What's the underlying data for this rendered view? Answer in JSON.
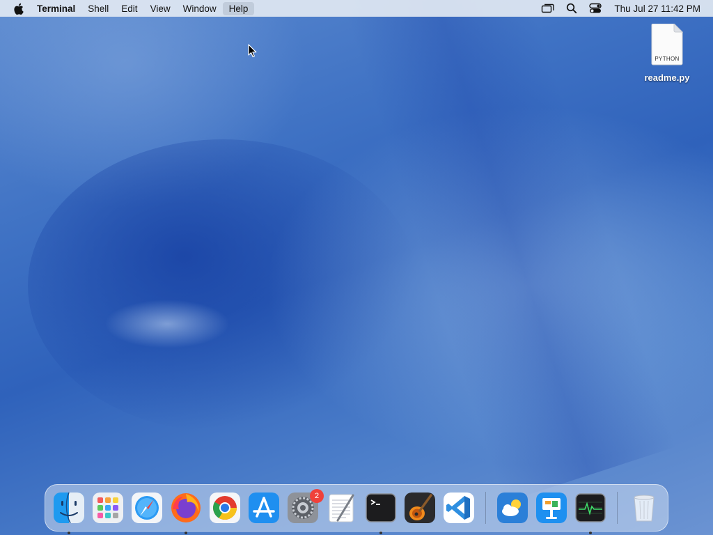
{
  "menubar": {
    "app_name": "Terminal",
    "items": [
      "Shell",
      "Edit",
      "View",
      "Window",
      "Help"
    ],
    "clock": "Thu Jul 27  11:42 PM",
    "status_icons": [
      "screen-mirroring-icon",
      "spotlight-search-icon",
      "control-center-icon"
    ]
  },
  "desktop": {
    "file": {
      "name": "readme.py",
      "type_label": "PYTHON",
      "icon": "python-file-icon"
    }
  },
  "dock": {
    "apps": [
      {
        "name": "Finder",
        "icon": "finder-icon",
        "running": true
      },
      {
        "name": "Launchpad",
        "icon": "launchpad-icon",
        "running": false
      },
      {
        "name": "Safari",
        "icon": "safari-icon",
        "running": false
      },
      {
        "name": "Firefox",
        "icon": "firefox-icon",
        "running": true
      },
      {
        "name": "Google Chrome",
        "icon": "chrome-icon",
        "running": false
      },
      {
        "name": "App Store",
        "icon": "app-store-icon",
        "running": false
      },
      {
        "name": "System Settings",
        "icon": "system-settings-icon",
        "running": false,
        "badge": "2"
      },
      {
        "name": "TextEdit",
        "icon": "textedit-icon",
        "running": false
      },
      {
        "name": "Terminal",
        "icon": "terminal-icon",
        "running": true
      },
      {
        "name": "GarageBand",
        "icon": "garageband-icon",
        "running": false
      },
      {
        "name": "Visual Studio Code",
        "icon": "vscode-icon",
        "running": false
      }
    ],
    "others": [
      {
        "name": "Weather",
        "icon": "weather-icon",
        "running": false
      },
      {
        "name": "Keynote",
        "icon": "keynote-icon",
        "running": false
      },
      {
        "name": "Activity Monitor",
        "icon": "activity-monitor-icon",
        "running": true
      }
    ],
    "trash": {
      "name": "Trash",
      "icon": "trash-icon"
    }
  }
}
